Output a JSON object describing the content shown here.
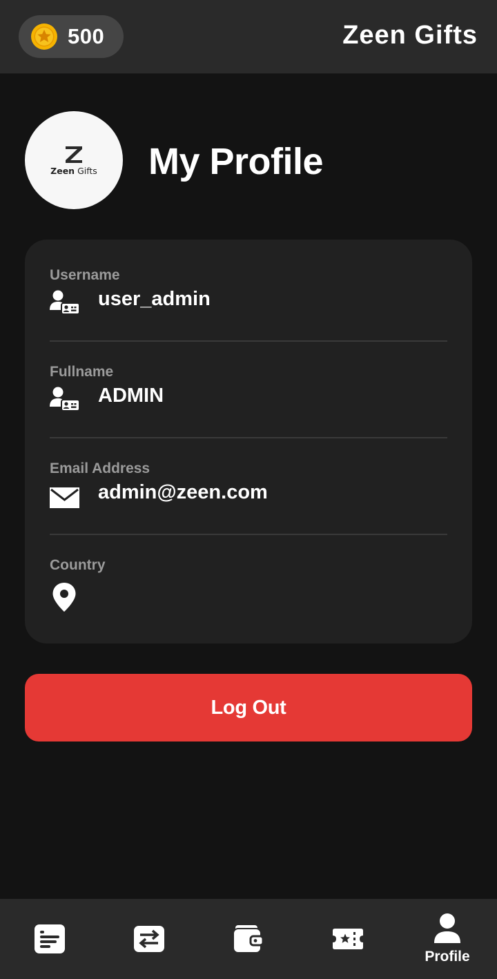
{
  "header": {
    "coin_icon": "star-coin-icon",
    "coin_count": "500",
    "app_title": "Zeen Gifts"
  },
  "profile": {
    "avatar_logo_text_bold": "Zeen",
    "avatar_logo_text_light": "Gifts",
    "title": "My Profile"
  },
  "fields": [
    {
      "label": "Username",
      "icon": "user-id-card-icon",
      "value": "user_admin"
    },
    {
      "label": "Fullname",
      "icon": "user-id-card-icon",
      "value": "ADMIN"
    },
    {
      "label": "Email Address",
      "icon": "envelope-icon",
      "value": "admin@zeen.com"
    },
    {
      "label": "Country",
      "icon": "location-pin-icon",
      "value": ""
    }
  ],
  "actions": {
    "logout_label": "Log Out"
  },
  "bottom_nav": {
    "items": [
      {
        "icon": "list-icon",
        "label": ""
      },
      {
        "icon": "transfer-arrows-icon",
        "label": ""
      },
      {
        "icon": "wallet-icon",
        "label": ""
      },
      {
        "icon": "ticket-star-icon",
        "label": ""
      },
      {
        "icon": "person-icon",
        "label": "Profile",
        "active": true
      }
    ]
  },
  "colors": {
    "background": "#131313",
    "header": "#2a2a2a",
    "card": "#212121",
    "accent_red": "#e53935",
    "label_gray": "#9b9b9b",
    "coin_gold": "#f5b301"
  }
}
